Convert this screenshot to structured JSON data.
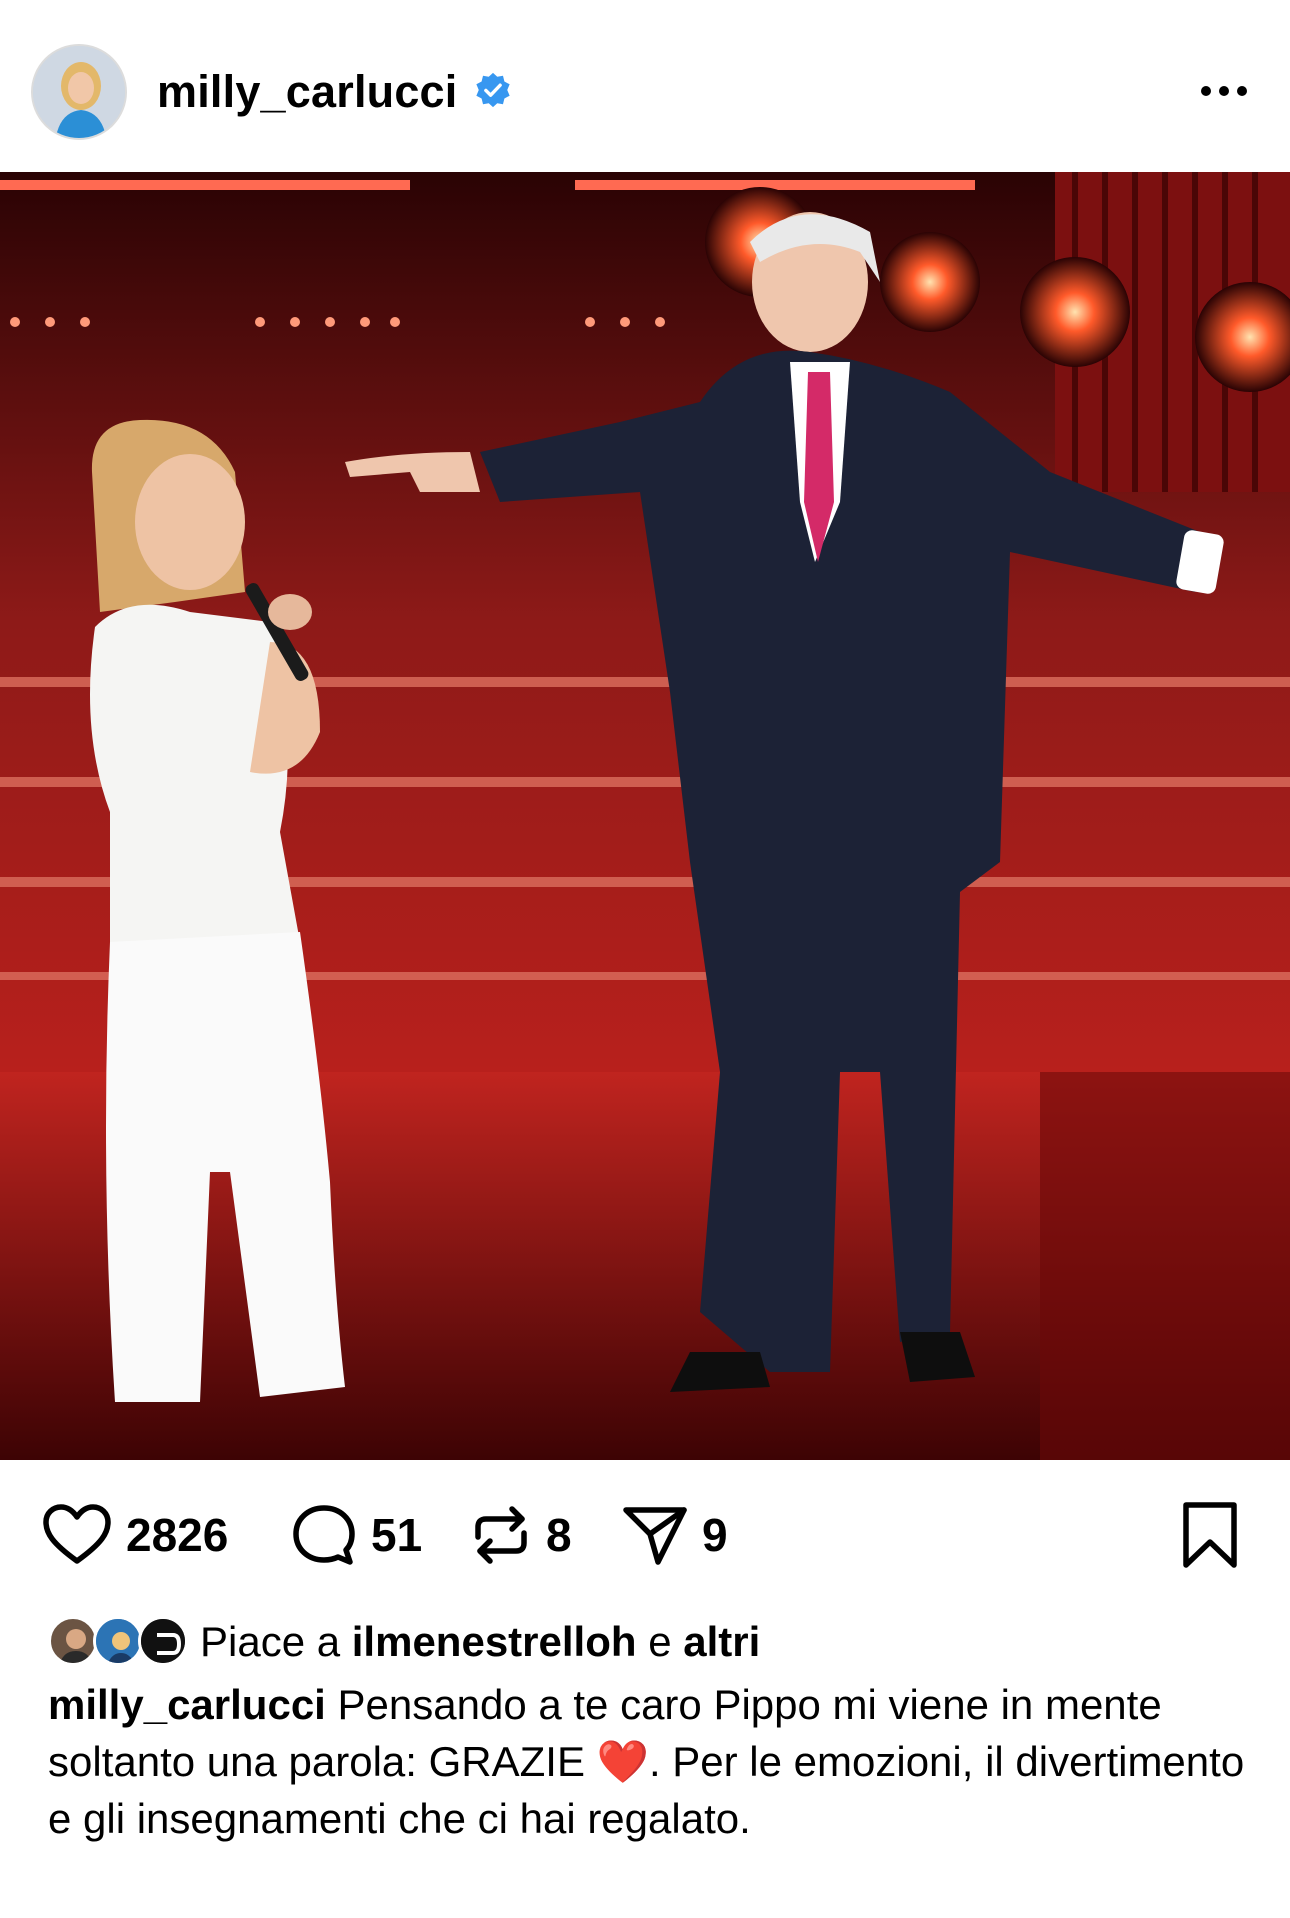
{
  "post": {
    "username": "milly_carlucci",
    "verified": true,
    "more_icon": "ellipsis-icon",
    "stats": {
      "likes": "2826",
      "comments": "51",
      "reposts": "8",
      "shares": "9"
    },
    "liked_by": {
      "prefix": "Piace a",
      "user": "ilmenestrelloh",
      "connector": "e",
      "others": "altri"
    },
    "caption": {
      "username": "milly_carlucci",
      "text_before_heart": "Pensando a te caro Pippo mi viene in mente soltanto una parola: GRAZIE",
      "emoji": "❤️",
      "text_after_heart": ". Per le emozioni, il divertimento e gli insegnamenti che ci hai regalato."
    }
  },
  "colors": {
    "verified_blue": "#3797f0",
    "stage_red": "#b30f14",
    "suit_navy": "#1c2236",
    "heart_red": "#e0162b"
  }
}
